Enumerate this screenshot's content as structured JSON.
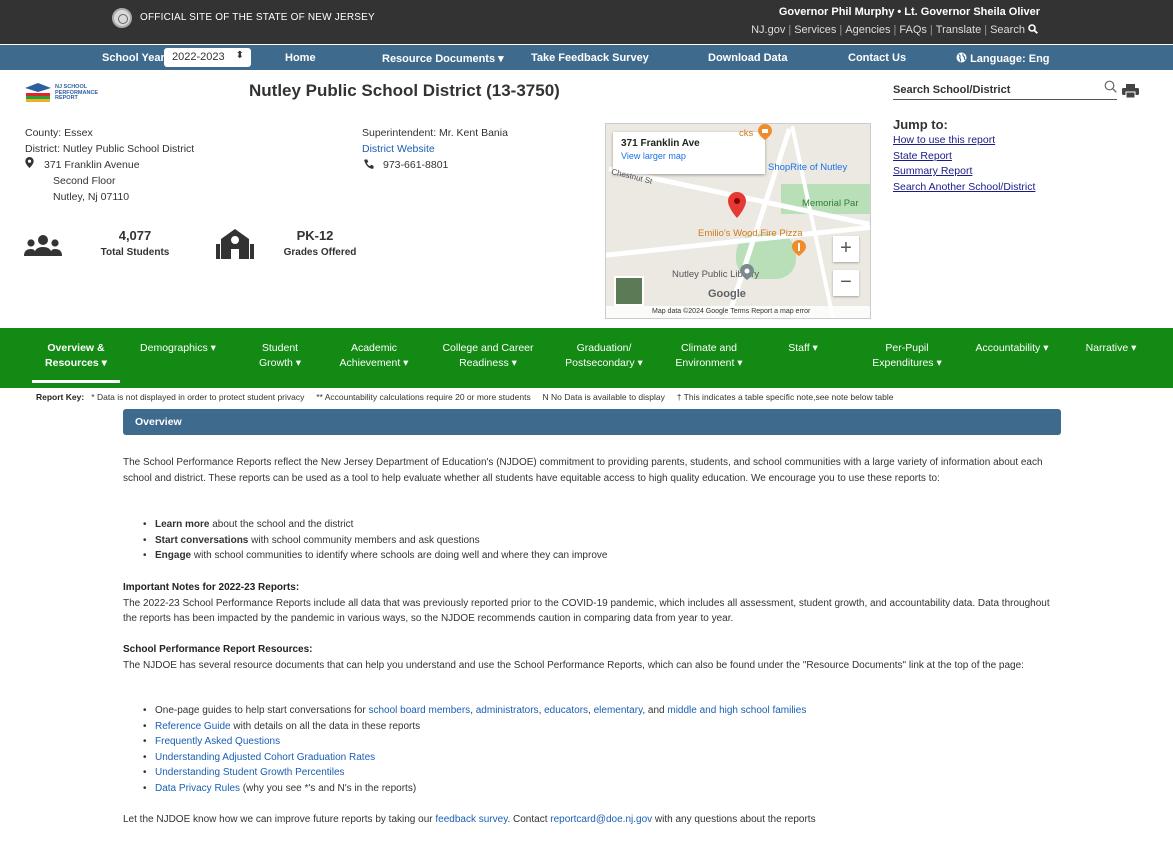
{
  "state_bar": {
    "official_text": "OFFICIAL SITE OF THE STATE OF NEW JERSEY",
    "governor_text": "Governor Phil Murphy • Lt. Governor Sheila Oliver",
    "links": [
      "NJ.gov",
      "Services",
      "Agencies",
      "FAQs",
      "Translate",
      "Search"
    ]
  },
  "blue_nav": {
    "school_year_label": "School Year",
    "school_year_value": "2022-2023",
    "home": "Home",
    "resource_documents": "Resource Documents ▾",
    "feedback": "Take Feedback Survey",
    "download": "Download Data",
    "contact": "Contact Us",
    "language": "Language: Eng"
  },
  "logo": {
    "line1": "NJ SCHOOL",
    "line2": "PERFORMANCE",
    "line3": "REPORT"
  },
  "header": {
    "title": "Nutley Public School District (13-3750)",
    "search_placeholder": "Search School/District"
  },
  "district_info": {
    "county": "County: Essex",
    "district": "District: Nutley Public School District",
    "address1": "371 Franklin Avenue",
    "address2": "Second Floor",
    "address3": "Nutley, Nj 07110",
    "superintendent": "Superintendent: Mr. Kent Bania",
    "website": "District Website",
    "phone": "973-661-8801"
  },
  "stats": {
    "students_value": "4,077",
    "students_label": "Total Students",
    "grades_value": "PK-12",
    "grades_label": "Grades Offered"
  },
  "map": {
    "card_title": "371 Franklin Ave",
    "card_link": "View larger map",
    "labels": {
      "shoprite": "ShopRite of Nutley",
      "memorial": "Memorial Par",
      "emilios": "Emilio's Wood Fire Pizza",
      "library": "Nutley Public Library",
      "chestnut": "Chestnut St",
      "starbucks": "cks",
      "google": "Google"
    },
    "footer": "Map data ©2024 Google   Terms   Report a map error"
  },
  "jump": {
    "title": "Jump to:",
    "links": [
      "How to use this report",
      "State Report",
      "Summary Report",
      "Search Another School/District"
    ]
  },
  "green_nav": [
    {
      "l1": "Overview &",
      "l2": "Resources ▾"
    },
    {
      "l1": "Demographics ▾",
      "l2": ""
    },
    {
      "l1": "Student",
      "l2": "Growth ▾"
    },
    {
      "l1": "Academic",
      "l2": "Achievement ▾"
    },
    {
      "l1": "College and Career",
      "l2": "Readiness ▾"
    },
    {
      "l1": "Graduation/",
      "l2": "Postsecondary ▾"
    },
    {
      "l1": "Climate and",
      "l2": "Environment ▾"
    },
    {
      "l1": "Staff ▾",
      "l2": ""
    },
    {
      "l1": "Per-Pupil",
      "l2": "Expenditures ▾"
    },
    {
      "l1": "Accountability ▾",
      "l2": ""
    },
    {
      "l1": "Narrative ▾",
      "l2": ""
    }
  ],
  "report_key": {
    "label": "Report Key:",
    "items": [
      "* Data is not displayed in order to protect student privacy",
      "** Accountability calculations require 20 or more students",
      "N No Data is available to display",
      "† This indicates a table specific note,see note below table"
    ]
  },
  "overview": {
    "bar_title": "Overview",
    "intro": "The School Performance Reports reflect the New Jersey Department of Education's (NJDOE) commitment to providing parents, students, and school communities with a large variety of information about each school and district. These reports can be used as a tool to help evaluate whether all students have equitable access to high quality education. We encourage you to use these reports to:",
    "bullets": [
      {
        "bold": "Learn more",
        "rest": " about the school and the district"
      },
      {
        "bold": "Start conversations",
        "rest": " with school community members and ask questions"
      },
      {
        "bold": "Engage",
        "rest": " with school communities to identify where schools are doing well and where they can improve"
      }
    ],
    "notes_title": "Important Notes for 2022-23 Reports:",
    "notes_text": "The 2022-23 School Performance Reports include all data that was previously reported prior to the COVID-19 pandemic, which includes all assessment, student growth, and accountability data. Data throughout the reports has been impacted by the pandemic in various ways, so the NJDOE recommends caution in comparing data from year to year.",
    "resources_title": "School Performance Report Resources:",
    "resources_text": "The NJDOE has several resource documents that can help you understand and use the School Performance Reports, which can also be found under the \"Resource Documents\" link at the top of the page:",
    "resource_guides_prefix": "One-page guides to help start conversations for ",
    "guide_links": [
      "school board members",
      "administrators",
      "educators",
      "elementary",
      "middle and high school families"
    ],
    "ref_guide_link": "Reference Guide",
    "ref_guide_rest": " with details on all the data in these reports",
    "faq": "Frequently Asked Questions",
    "acgr": "Understanding Adjusted Cohort Graduation Rates",
    "sgp": "Understanding Student Growth Percentiles",
    "privacy_link": "Data Privacy Rules",
    "privacy_rest": " (why you see *'s and N's in the reports)",
    "footer_prefix": "Let the NJDOE know how we can improve future reports by taking our ",
    "footer_link1": "feedback survey",
    "footer_mid": ". Contact ",
    "footer_link2": "reportcard@doe.nj.gov",
    "footer_suffix": " with any questions about the reports"
  }
}
